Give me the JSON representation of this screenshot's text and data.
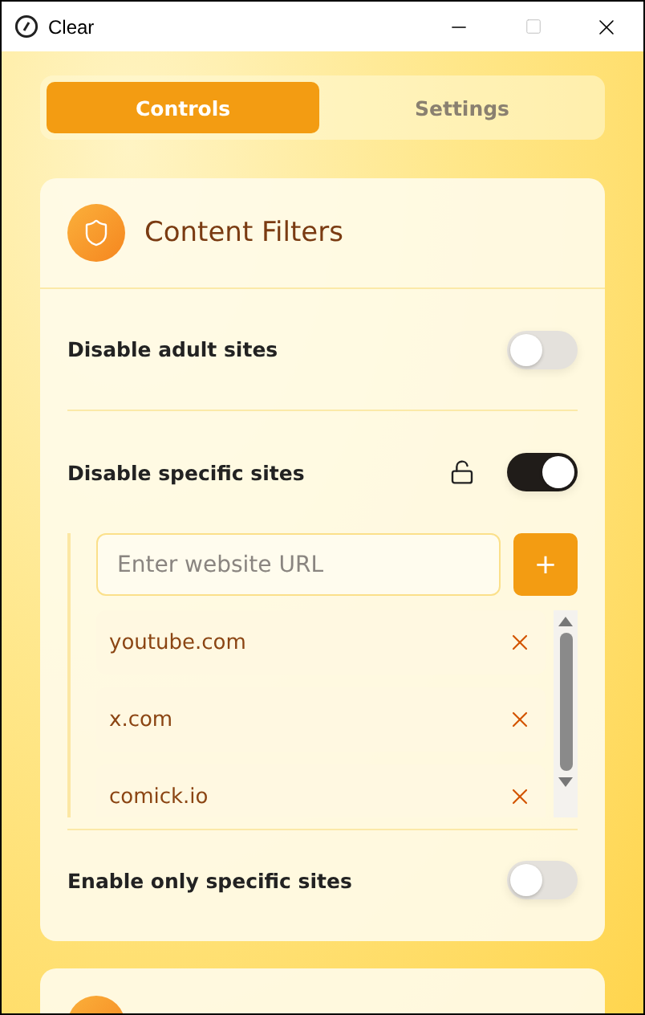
{
  "window": {
    "title": "Clear"
  },
  "tabs": [
    {
      "label": "Controls",
      "selected": true
    },
    {
      "label": "Settings",
      "selected": false
    }
  ],
  "section": {
    "title": "Content Filters",
    "settings": [
      {
        "kind": "toggle",
        "label": "Disable adult sites",
        "on": false
      },
      {
        "kind": "sitelist",
        "label": "Disable specific sites",
        "on": true,
        "locked": false,
        "placeholder": "Enter website URL",
        "add": "+",
        "sites": [
          "youtube.com",
          "x.com",
          "comick.io"
        ]
      },
      {
        "kind": "toggle",
        "label": "Enable only specific sites",
        "on": false
      }
    ]
  }
}
